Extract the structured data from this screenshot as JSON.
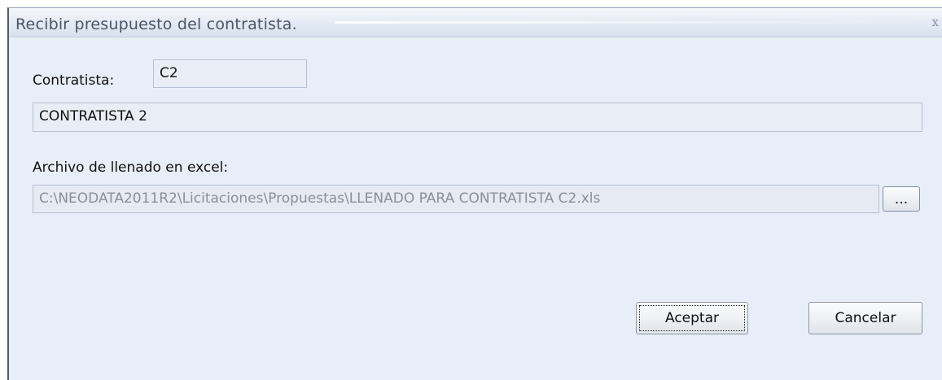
{
  "window": {
    "title": "Recibir presupuesto del contratista.",
    "close_glyph": "x"
  },
  "form": {
    "contratista_label": "Contratista:",
    "contratista_code": "C2",
    "contratista_name": "CONTRATISTA 2",
    "archivo_label": "Archivo de llenado en excel:",
    "archivo_path": "C:\\NEODATA2011R2\\Licitaciones\\Propuestas\\LLENADO PARA CONTRATISTA C2.xls",
    "browse_label": "..."
  },
  "buttons": {
    "accept_label": "Aceptar",
    "cancel_label": "Cancelar"
  }
}
